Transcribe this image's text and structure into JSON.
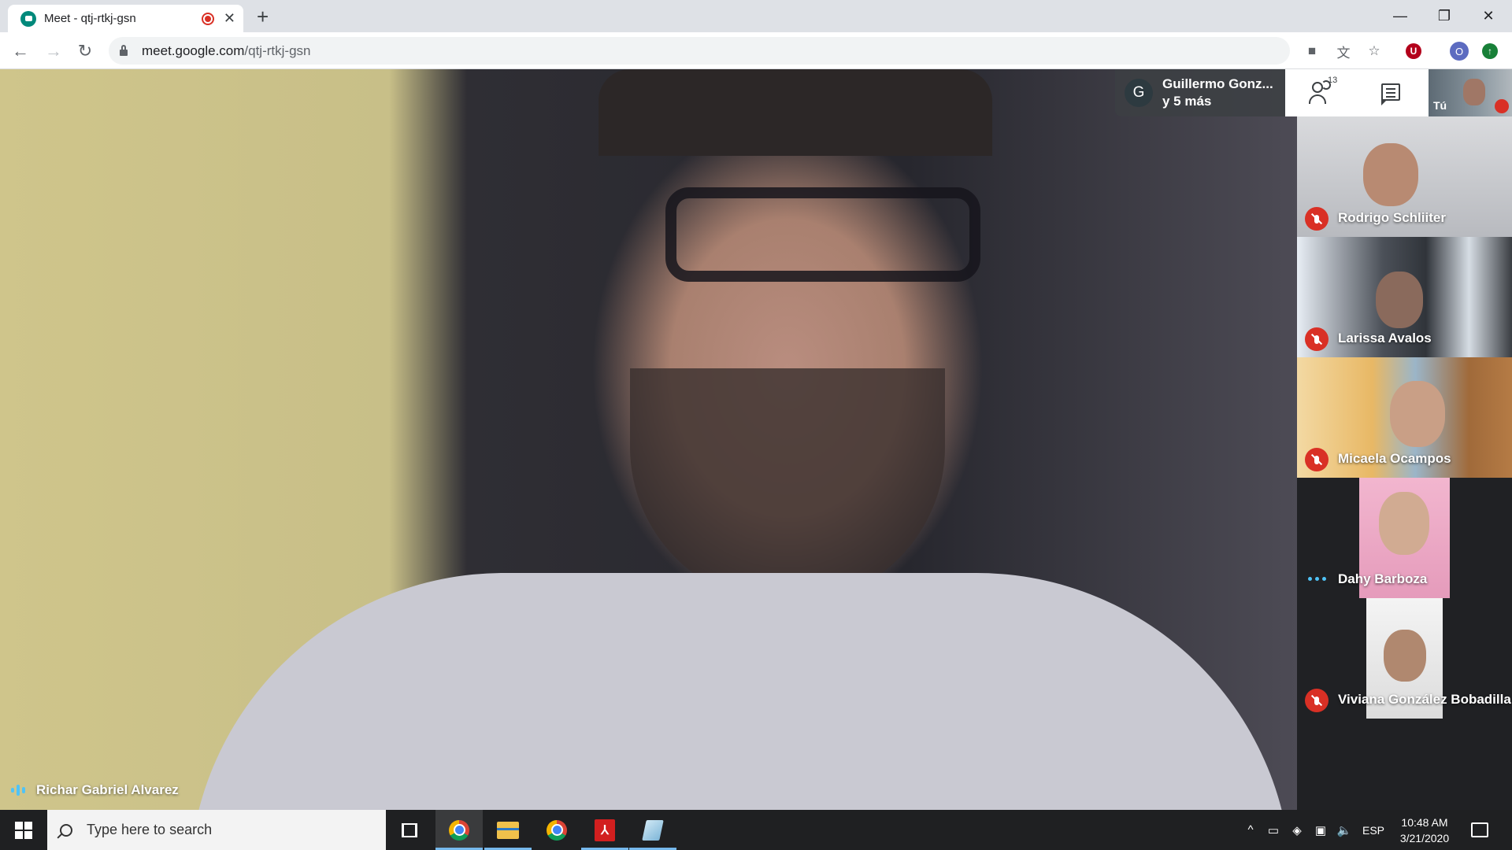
{
  "browser": {
    "tab_title": "Meet - qtj-rtkj-gsn",
    "new_tab": "+",
    "tab_close": "✕",
    "url_domain": "meet.google.com",
    "url_path": "/qtj-rtkj-gsn",
    "nav": {
      "back": "←",
      "forward": "→",
      "reload": "↻"
    },
    "window": {
      "minimize": "—",
      "restore": "❐",
      "close": "✕"
    },
    "profile_initial": "O",
    "extension_initial": "U",
    "update_arrow": "↑"
  },
  "meet": {
    "main_speaker": "Richar Gabriel Alvarez",
    "presenter_chip": {
      "avatar": "G",
      "line1": "Guillermo Gonz...",
      "line2": "y 5 más"
    },
    "participant_count": "13",
    "self_label": "Tú",
    "participants": [
      {
        "name": "Rodrigo Schliiter",
        "status": "muted"
      },
      {
        "name": "Larissa Avalos",
        "status": "muted"
      },
      {
        "name": "Micaela Ocampos",
        "status": "muted"
      },
      {
        "name": "Dahy Barboza",
        "status": "speaking"
      },
      {
        "name": "Viviana González Bobadilla",
        "status": "muted"
      }
    ]
  },
  "taskbar": {
    "search_placeholder": "Type here to search",
    "language": "ESP",
    "time": "10:48 AM",
    "date": "3/21/2020",
    "tray_chevron": "^",
    "volume": "🔈"
  }
}
